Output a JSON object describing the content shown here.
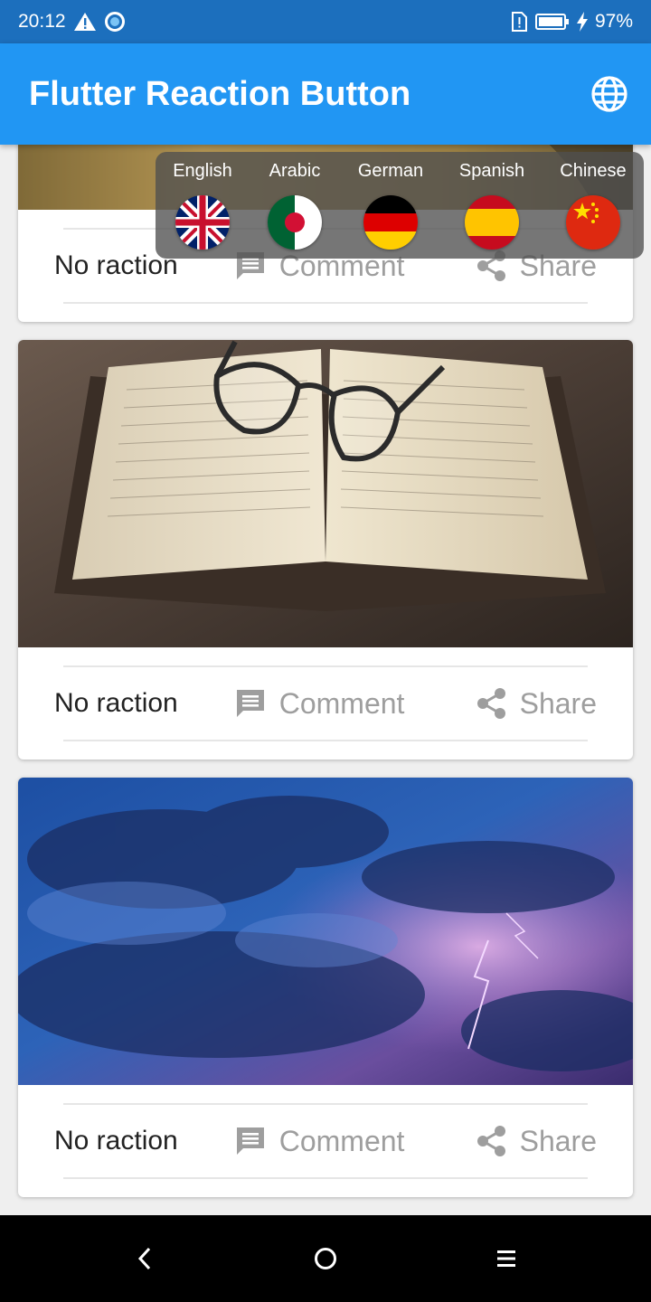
{
  "status_bar": {
    "time": "20:12",
    "battery": "97%",
    "icons": [
      "warning-icon",
      "sync-circle-icon",
      "sim-alert-icon",
      "battery-icon",
      "charging-bolt-icon"
    ]
  },
  "app_bar": {
    "title": "Flutter Reaction Button",
    "action_icon": "globe-icon"
  },
  "language_popup": {
    "items": [
      {
        "label": "English",
        "flag_icon": "uk-flag-icon"
      },
      {
        "label": "Arabic",
        "flag_icon": "algeria-flag-icon"
      },
      {
        "label": "German",
        "flag_icon": "germany-flag-icon"
      },
      {
        "label": "Spanish",
        "flag_icon": "spain-flag-icon"
      },
      {
        "label": "Chinese",
        "flag_icon": "china-flag-icon"
      }
    ]
  },
  "cards": [
    {
      "image": "wheat-field-photo",
      "reaction": "No raction",
      "comment": "Comment",
      "share": "Share"
    },
    {
      "image": "open-book-with-glasses-photo",
      "reaction": "No raction",
      "comment": "Comment",
      "share": "Share"
    },
    {
      "image": "storm-clouds-lightning-photo",
      "reaction": "No raction",
      "comment": "Comment",
      "share": "Share"
    }
  ],
  "nav_bar": {
    "icons": [
      "back-icon",
      "home-icon",
      "menu-icon"
    ]
  },
  "colors": {
    "status_bar": "#1c6fbd",
    "app_bar": "#2196f3",
    "action_gray": "#9e9e9e",
    "popup_bg": "rgba(80,80,80,0.78)"
  }
}
